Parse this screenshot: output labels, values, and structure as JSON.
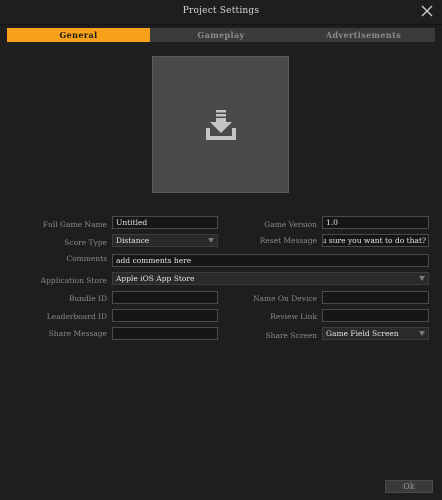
{
  "window": {
    "title": "Project Settings"
  },
  "tabs": [
    "General",
    "Gameplay",
    "Advertisements"
  ],
  "app_icon": {
    "icon": "download-icon"
  },
  "form": {
    "full_game_name": {
      "label": "Full Game Name",
      "value": "Untitled"
    },
    "game_version": {
      "label": "Game Version",
      "value": "1.0"
    },
    "score_type": {
      "label": "Score Type",
      "value": "Distance"
    },
    "reset_message": {
      "label": "Reset Message",
      "value": "Are you sure you want to do that?"
    },
    "comments": {
      "label": "Comments",
      "value": "add comments here"
    },
    "application_store": {
      "label": "Application Store",
      "value": "Apple iOS App Store"
    },
    "bundle_id": {
      "label": "Bundle ID",
      "value": ""
    },
    "name_on_device": {
      "label": "Name On Device",
      "value": ""
    },
    "leaderboard_id": {
      "label": "Leaderboard ID",
      "value": ""
    },
    "review_link": {
      "label": "Review Link",
      "value": ""
    },
    "share_message": {
      "label": "Share Message",
      "value": ""
    },
    "share_screen": {
      "label": "Share Screen",
      "value": "Game Field Screen"
    }
  },
  "buttons": {
    "ok": "Ok"
  }
}
